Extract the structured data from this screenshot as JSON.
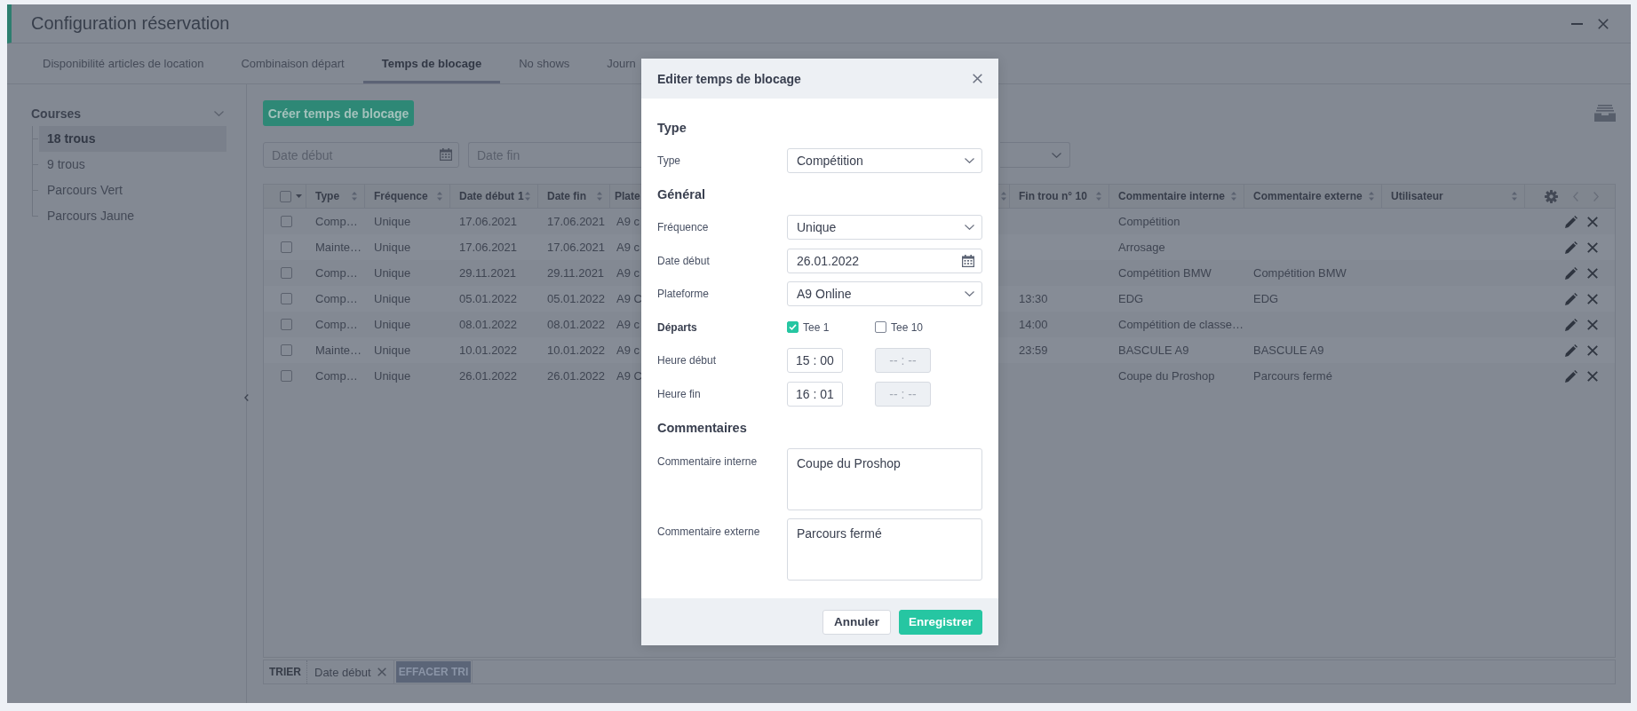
{
  "window": {
    "title": "Configuration réservation"
  },
  "tabs": [
    {
      "label": "Disponibilité articles de location",
      "selected": false
    },
    {
      "label": "Combinaison départ",
      "selected": false
    },
    {
      "label": "Temps de blocage",
      "selected": true
    },
    {
      "label": "No shows",
      "selected": false
    },
    {
      "label": "Journ",
      "selected": false
    }
  ],
  "sidebar": {
    "tree": [
      {
        "label": "Courses",
        "expanded": true,
        "children": [
          {
            "label": "18 trous",
            "selected": true
          },
          {
            "label": "9 trous",
            "selected": false
          },
          {
            "label": "Parcours Vert",
            "selected": false
          },
          {
            "label": "Parcours Jaune",
            "selected": false
          }
        ]
      }
    ]
  },
  "toolbar": {
    "create_button": "Créer temps de blocage"
  },
  "filters": [
    {
      "kind": "date",
      "placeholder": "Date début"
    },
    {
      "kind": "text",
      "placeholder": "Date fin"
    },
    {
      "kind": "select"
    }
  ],
  "table": {
    "select_all_checked": false,
    "left_columns": [
      {
        "label": "Type",
        "sortable": true
      },
      {
        "label": "Fréquence",
        "sortable": true
      },
      {
        "label": "Date début",
        "sort_order": "1",
        "sortable": true
      },
      {
        "label": "Date fin",
        "sortable": true
      },
      {
        "label": "Plate"
      }
    ],
    "right_columns": [
      {
        "sortable": true
      },
      {
        "label": "Fin trou n° 10",
        "sortable": true
      },
      {
        "label": "Commentaire interne",
        "sortable": true
      },
      {
        "label": "Commentaire externe",
        "sortable": true
      },
      {
        "label": "Utilisateur",
        "sortable": true
      }
    ],
    "rows": [
      {
        "checked": false,
        "type": "Comp…",
        "frequency": "Unique",
        "date_start": "17.06.2021",
        "date_end": "17.06.2021",
        "column_6": "A9 c",
        "internal_comment": "Compétition"
      },
      {
        "checked": false,
        "type": "Mainte…",
        "frequency": "Unique",
        "date_start": "17.06.2021",
        "date_end": "17.06.2021",
        "column_6": "A9 c",
        "internal_comment": "Arrosage"
      },
      {
        "checked": false,
        "type": "Comp…",
        "frequency": "Unique",
        "date_start": "29.11.2021",
        "date_end": "29.11.2021",
        "column_6": "A9 c",
        "internal_comment": "Compétition BMW",
        "external_comment": "Compétition BMW"
      },
      {
        "checked": false,
        "type": "Comp…",
        "frequency": "Unique",
        "date_start": "05.01.2022",
        "date_end": "05.01.2022",
        "column_6": "A9 C",
        "end_hole_10": "13:30",
        "internal_comment": "EDG",
        "external_comment": "EDG"
      },
      {
        "checked": false,
        "type": "Comp…",
        "frequency": "Unique",
        "date_start": "08.01.2022",
        "date_end": "08.01.2022",
        "column_6": "A9 c",
        "end_hole_10": "14:00",
        "internal_comment": "Compétition de classe…"
      },
      {
        "checked": false,
        "type": "Mainte…",
        "frequency": "Unique",
        "date_start": "10.01.2022",
        "date_end": "10.01.2022",
        "column_6": "A9 c",
        "end_hole_10": "23:59",
        "internal_comment": "BASCULE A9",
        "external_comment": "BASCULE A9"
      },
      {
        "checked": false,
        "type": "Comp…",
        "frequency": "Unique",
        "date_start": "26.01.2022",
        "date_end": "26.01.2022",
        "column_6": "A9 C",
        "internal_comment": "Coupe du Proshop",
        "external_comment": "Parcours fermé"
      }
    ]
  },
  "sort_bar": {
    "label": "TRIER",
    "chips": [
      "Date début"
    ],
    "clear_button": "EFFACER TRI"
  },
  "dialog": {
    "title": "Editer temps de blocage",
    "sections": [
      {
        "heading": "Type",
        "fields": [
          {
            "kind": "select",
            "label": "Type",
            "value": "Compétition"
          }
        ]
      },
      {
        "heading": "Général",
        "fields": [
          {
            "kind": "select",
            "label": "Fréquence",
            "value": "Unique"
          },
          {
            "kind": "date",
            "label": "Date début",
            "value": "26.01.2022"
          },
          {
            "kind": "select",
            "label": "Plateforme",
            "value": "A9 Online"
          },
          {
            "kind": "checkboxes",
            "label": "Départs",
            "options": [
              {
                "label": "Tee 1",
                "checked": true
              },
              {
                "label": "Tee 10",
                "checked": false
              }
            ]
          },
          {
            "kind": "time",
            "label": "Heure début",
            "times": [
              {
                "value": "15 : 00",
                "disabled": false
              },
              {
                "placeholder": "-- : --",
                "disabled": true
              }
            ]
          },
          {
            "kind": "time",
            "label": "Heure fin",
            "times": [
              {
                "value": "16 : 01",
                "disabled": false
              },
              {
                "placeholder": "-- : --",
                "disabled": true
              }
            ]
          }
        ]
      },
      {
        "heading": "Commentaires",
        "fields": [
          {
            "kind": "textarea",
            "label": "Commentaire interne",
            "value": "Coupe du Proshop"
          },
          {
            "kind": "textarea",
            "label": "Commentaire externe",
            "value": "Parcours fermé"
          }
        ]
      }
    ],
    "buttons": [
      {
        "kind": "secondary",
        "label": "Annuler"
      },
      {
        "kind": "primary",
        "label": "Enregistrer"
      }
    ]
  }
}
